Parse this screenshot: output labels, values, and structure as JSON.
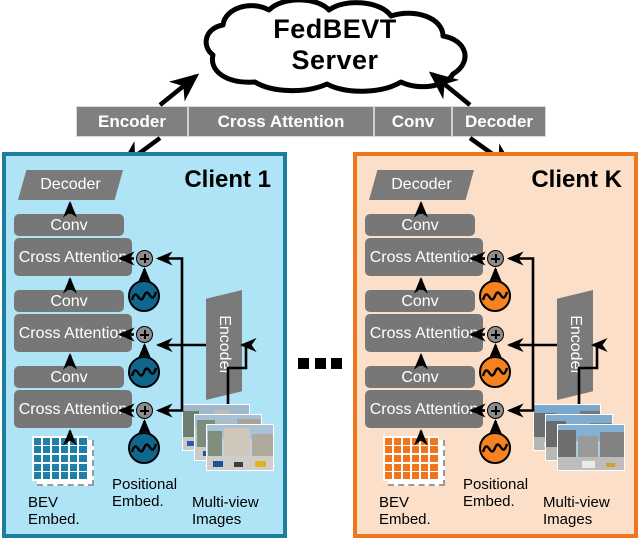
{
  "server": {
    "cloud_label": "FedBEVT\nServer",
    "cloud_line1": "FedBEVT",
    "cloud_line2": "Server",
    "modules": [
      {
        "label": "Encoder"
      },
      {
        "label": "Cross Attention"
      },
      {
        "label": "Conv"
      },
      {
        "label": "Decoder"
      }
    ]
  },
  "clients": [
    {
      "title": "Client 1",
      "accent": "#1a7e9c",
      "fill": "#aee4f5",
      "pe_color": "#11668e",
      "bev_color": "#1f7fa8",
      "decoder_label": "Decoder",
      "encoder_label": "Encoder",
      "stack": [
        {
          "label": "Conv"
        },
        {
          "label": "Cross Attention"
        },
        {
          "label": "Conv"
        },
        {
          "label": "Cross Attention"
        },
        {
          "label": "Conv"
        },
        {
          "label": "Cross Attention"
        }
      ],
      "captions": {
        "bev": "BEV\nEmbed.",
        "bev_line1": "BEV",
        "bev_line2": "Embed.",
        "pe_line1": "Positional",
        "pe_line2": "Embed.",
        "mv_line1": "Multi-view",
        "mv_line2": "Images"
      }
    },
    {
      "title": "Client K",
      "accent": "#f0761e",
      "fill": "#fbdfc8",
      "pe_color": "#f5821f",
      "bev_color": "#f0761e",
      "decoder_label": "Decoder",
      "encoder_label": "Encoder",
      "stack": [
        {
          "label": "Conv"
        },
        {
          "label": "Cross Attention"
        },
        {
          "label": "Conv"
        },
        {
          "label": "Cross Attention"
        },
        {
          "label": "Conv"
        },
        {
          "label": "Cross Attention"
        }
      ],
      "captions": {
        "bev": "BEV\nEmbed.",
        "bev_line1": "BEV",
        "bev_line2": "Embed.",
        "pe_line1": "Positional",
        "pe_line2": "Embed.",
        "mv_line1": "Multi-view",
        "mv_line2": "Images"
      }
    }
  ],
  "ellipsis": "•••",
  "colors": {
    "block_gray": "#777777",
    "server_gray": "#808080",
    "client1_border": "#1a7e9c",
    "client1_fill": "#aee4f5",
    "clientk_border": "#f0761e",
    "clientk_fill": "#fbdfc8"
  }
}
